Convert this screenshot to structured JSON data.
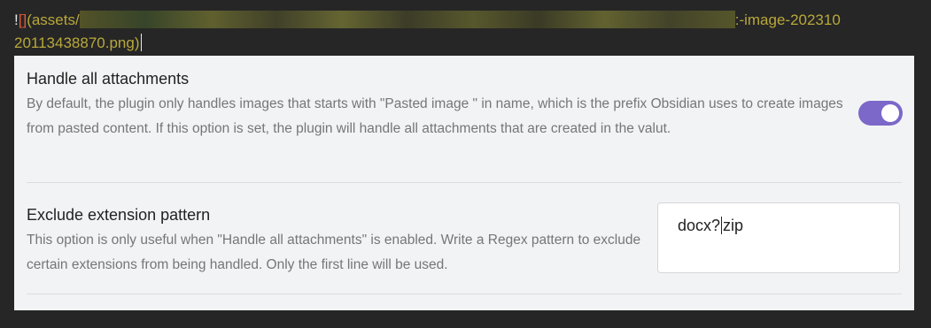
{
  "editor": {
    "bang": "!",
    "bracket": "[]",
    "link_prefix": "(assets/",
    "link_suffix_line1": ":-image-202310",
    "link_line2": "20113438870.png)"
  },
  "settings": [
    {
      "name": "Handle all attachments",
      "description": "By default, the plugin only handles images that starts with \"Pasted image \" in name, which is the prefix Obsidian uses to create images from pasted content. If this option is set, the plugin will handle all attachments that are created in the valut.",
      "control": "toggle",
      "enabled": true
    },
    {
      "name": "Exclude extension pattern",
      "description": "This option is only useful when \"Handle all attachments\" is enabled. Write a Regex pattern to exclude certain extensions from being handled. Only the first line will be used.",
      "control": "textarea",
      "value_before_caret": "docx?",
      "value_after_caret": "zip"
    }
  ],
  "colors": {
    "accent": "#7b68c8",
    "link_text": "#b8a83a",
    "panel_bg": "#f2f3f5",
    "editor_bg": "#262626"
  }
}
